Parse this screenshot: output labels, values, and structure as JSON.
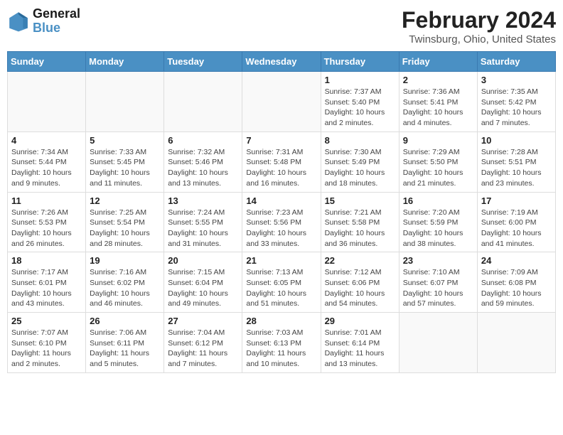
{
  "logo": {
    "text_general": "General",
    "text_blue": "Blue"
  },
  "header": {
    "title": "February 2024",
    "subtitle": "Twinsburg, Ohio, United States"
  },
  "weekdays": [
    "Sunday",
    "Monday",
    "Tuesday",
    "Wednesday",
    "Thursday",
    "Friday",
    "Saturday"
  ],
  "weeks": [
    [
      {
        "day": "",
        "info": ""
      },
      {
        "day": "",
        "info": ""
      },
      {
        "day": "",
        "info": ""
      },
      {
        "day": "",
        "info": ""
      },
      {
        "day": "1",
        "info": "Sunrise: 7:37 AM\nSunset: 5:40 PM\nDaylight: 10 hours\nand 2 minutes."
      },
      {
        "day": "2",
        "info": "Sunrise: 7:36 AM\nSunset: 5:41 PM\nDaylight: 10 hours\nand 4 minutes."
      },
      {
        "day": "3",
        "info": "Sunrise: 7:35 AM\nSunset: 5:42 PM\nDaylight: 10 hours\nand 7 minutes."
      }
    ],
    [
      {
        "day": "4",
        "info": "Sunrise: 7:34 AM\nSunset: 5:44 PM\nDaylight: 10 hours\nand 9 minutes."
      },
      {
        "day": "5",
        "info": "Sunrise: 7:33 AM\nSunset: 5:45 PM\nDaylight: 10 hours\nand 11 minutes."
      },
      {
        "day": "6",
        "info": "Sunrise: 7:32 AM\nSunset: 5:46 PM\nDaylight: 10 hours\nand 13 minutes."
      },
      {
        "day": "7",
        "info": "Sunrise: 7:31 AM\nSunset: 5:48 PM\nDaylight: 10 hours\nand 16 minutes."
      },
      {
        "day": "8",
        "info": "Sunrise: 7:30 AM\nSunset: 5:49 PM\nDaylight: 10 hours\nand 18 minutes."
      },
      {
        "day": "9",
        "info": "Sunrise: 7:29 AM\nSunset: 5:50 PM\nDaylight: 10 hours\nand 21 minutes."
      },
      {
        "day": "10",
        "info": "Sunrise: 7:28 AM\nSunset: 5:51 PM\nDaylight: 10 hours\nand 23 minutes."
      }
    ],
    [
      {
        "day": "11",
        "info": "Sunrise: 7:26 AM\nSunset: 5:53 PM\nDaylight: 10 hours\nand 26 minutes."
      },
      {
        "day": "12",
        "info": "Sunrise: 7:25 AM\nSunset: 5:54 PM\nDaylight: 10 hours\nand 28 minutes."
      },
      {
        "day": "13",
        "info": "Sunrise: 7:24 AM\nSunset: 5:55 PM\nDaylight: 10 hours\nand 31 minutes."
      },
      {
        "day": "14",
        "info": "Sunrise: 7:23 AM\nSunset: 5:56 PM\nDaylight: 10 hours\nand 33 minutes."
      },
      {
        "day": "15",
        "info": "Sunrise: 7:21 AM\nSunset: 5:58 PM\nDaylight: 10 hours\nand 36 minutes."
      },
      {
        "day": "16",
        "info": "Sunrise: 7:20 AM\nSunset: 5:59 PM\nDaylight: 10 hours\nand 38 minutes."
      },
      {
        "day": "17",
        "info": "Sunrise: 7:19 AM\nSunset: 6:00 PM\nDaylight: 10 hours\nand 41 minutes."
      }
    ],
    [
      {
        "day": "18",
        "info": "Sunrise: 7:17 AM\nSunset: 6:01 PM\nDaylight: 10 hours\nand 43 minutes."
      },
      {
        "day": "19",
        "info": "Sunrise: 7:16 AM\nSunset: 6:02 PM\nDaylight: 10 hours\nand 46 minutes."
      },
      {
        "day": "20",
        "info": "Sunrise: 7:15 AM\nSunset: 6:04 PM\nDaylight: 10 hours\nand 49 minutes."
      },
      {
        "day": "21",
        "info": "Sunrise: 7:13 AM\nSunset: 6:05 PM\nDaylight: 10 hours\nand 51 minutes."
      },
      {
        "day": "22",
        "info": "Sunrise: 7:12 AM\nSunset: 6:06 PM\nDaylight: 10 hours\nand 54 minutes."
      },
      {
        "day": "23",
        "info": "Sunrise: 7:10 AM\nSunset: 6:07 PM\nDaylight: 10 hours\nand 57 minutes."
      },
      {
        "day": "24",
        "info": "Sunrise: 7:09 AM\nSunset: 6:08 PM\nDaylight: 10 hours\nand 59 minutes."
      }
    ],
    [
      {
        "day": "25",
        "info": "Sunrise: 7:07 AM\nSunset: 6:10 PM\nDaylight: 11 hours\nand 2 minutes."
      },
      {
        "day": "26",
        "info": "Sunrise: 7:06 AM\nSunset: 6:11 PM\nDaylight: 11 hours\nand 5 minutes."
      },
      {
        "day": "27",
        "info": "Sunrise: 7:04 AM\nSunset: 6:12 PM\nDaylight: 11 hours\nand 7 minutes."
      },
      {
        "day": "28",
        "info": "Sunrise: 7:03 AM\nSunset: 6:13 PM\nDaylight: 11 hours\nand 10 minutes."
      },
      {
        "day": "29",
        "info": "Sunrise: 7:01 AM\nSunset: 6:14 PM\nDaylight: 11 hours\nand 13 minutes."
      },
      {
        "day": "",
        "info": ""
      },
      {
        "day": "",
        "info": ""
      }
    ]
  ]
}
